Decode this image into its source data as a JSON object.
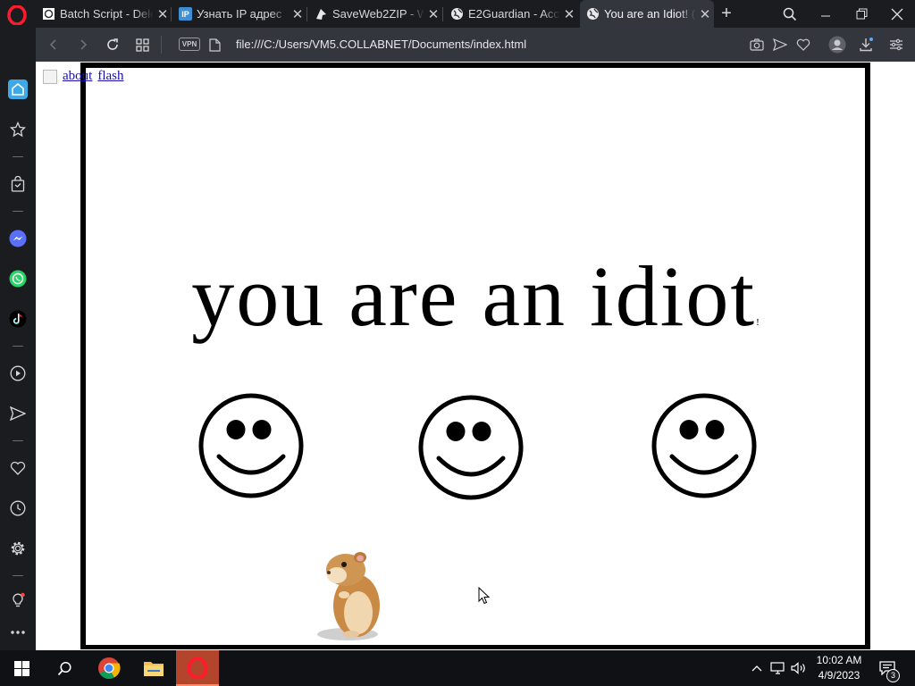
{
  "tabs": [
    {
      "title": "Batch Script - Dele",
      "icon": "batch-favicon-icon"
    },
    {
      "title": "Узнать IP адрес",
      "icon": "ip-favicon-icon"
    },
    {
      "title": "SaveWeb2ZIP - We",
      "icon": "saveweb2zip-favicon-icon"
    },
    {
      "title": "E2Guardian - Acce",
      "icon": "globe-icon"
    },
    {
      "title": "You are an Idiot! (",
      "icon": "globe-icon",
      "active": true
    }
  ],
  "addressbar": {
    "vpn_label": "VPN",
    "url": "file:///C:/Users/VM5.COLLABNET/Documents/index.html"
  },
  "page": {
    "link_about": "about",
    "link_flash": "flash",
    "headline": "you are an idiot",
    "headline_suffix": "!"
  },
  "taskbar": {
    "time": "10:02 AM",
    "date": "4/9/2023",
    "notification_count": "3"
  },
  "colors": {
    "opera_red": "#ff1b2d",
    "tab_active": "#34363d",
    "chrome_dark": "#1b1c20",
    "link_blue": "#1a0dab"
  }
}
